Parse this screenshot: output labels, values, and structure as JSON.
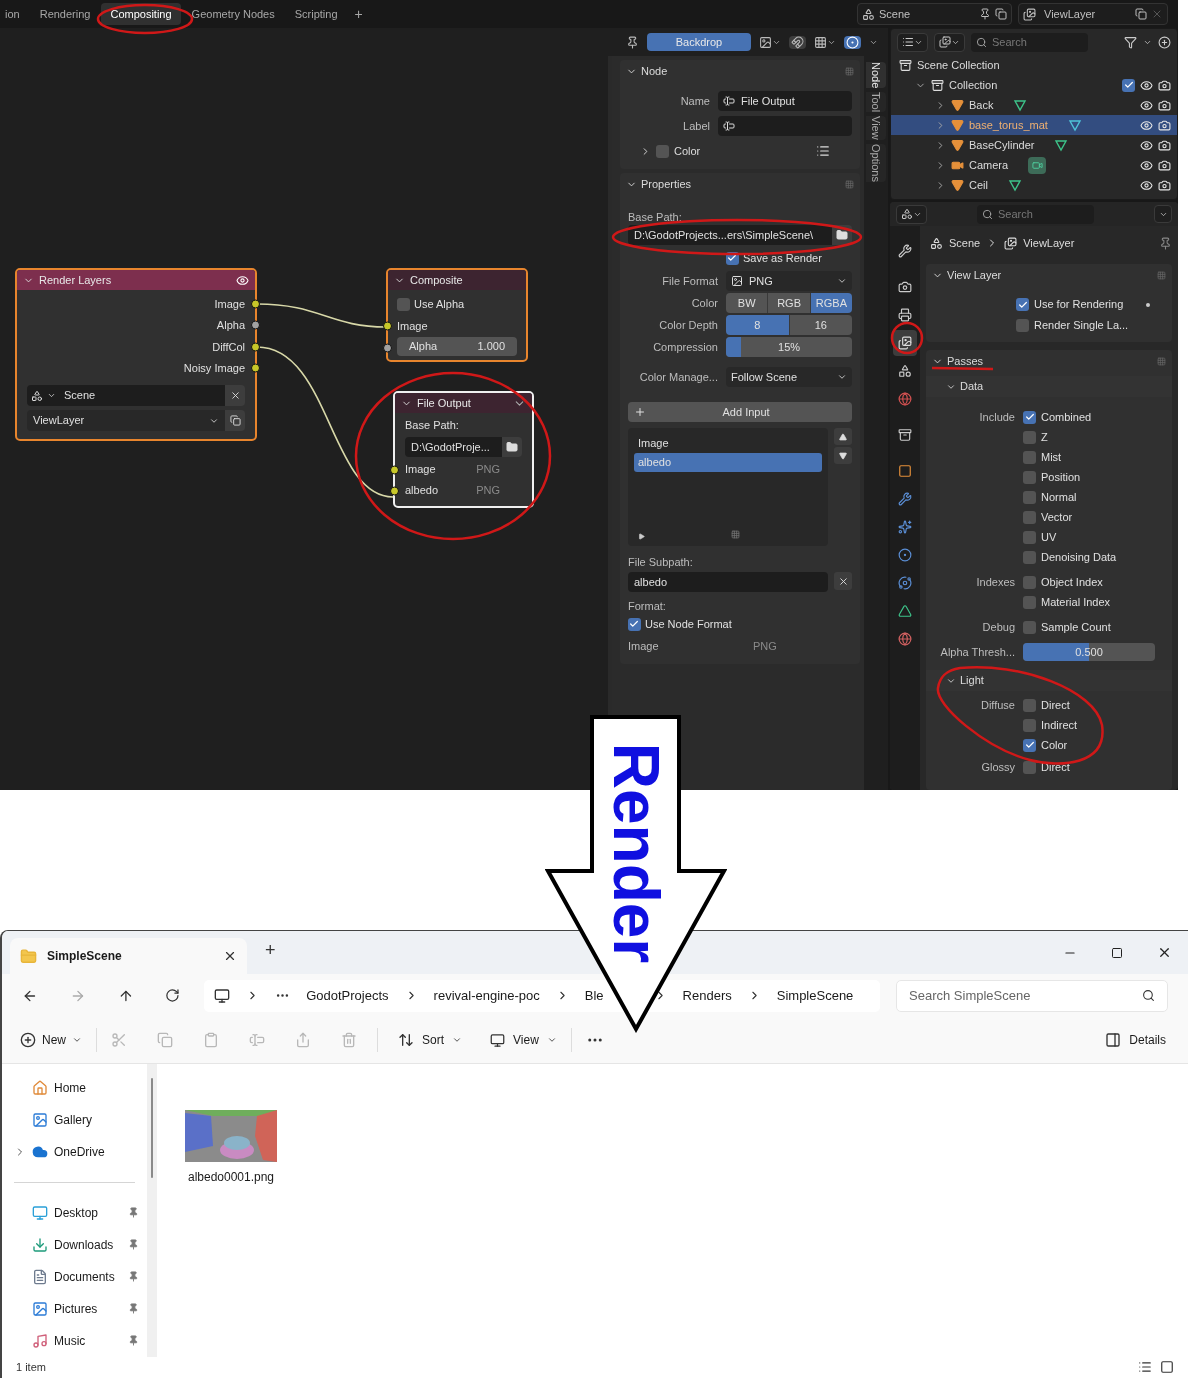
{
  "workspace_tabs": [
    {
      "label": "ion",
      "selected": false
    },
    {
      "label": "Rendering",
      "selected": false
    },
    {
      "label": "Compositing",
      "selected": true
    },
    {
      "label": "Geometry Nodes",
      "selected": false
    },
    {
      "label": "Scripting",
      "selected": false
    }
  ],
  "add_workspace": "+",
  "scene_selector": {
    "scene": "Scene",
    "view_layer": "ViewLayer"
  },
  "node_editor": {
    "backdrop": {
      "label": "Backdrop",
      "on": true
    },
    "render_layers": {
      "title": "Render Layers",
      "selected": true,
      "active": false,
      "outputs": [
        {
          "name": "Image",
          "color": "#c7c729"
        },
        {
          "name": "Alpha",
          "color": "#a1a1a1"
        },
        {
          "name": "DiffCol",
          "color": "#c7c729"
        },
        {
          "name": "Noisy Image",
          "color": "#c7c729"
        }
      ],
      "scene": "Scene",
      "view_layer": "ViewLayer"
    },
    "composite": {
      "title": "Composite",
      "selected": true,
      "active": false,
      "use_alpha": {
        "label": "Use Alpha",
        "checked": false
      },
      "inputs": [
        {
          "name": "Image",
          "color": "#c7c729"
        }
      ],
      "alpha": {
        "label": "Alpha",
        "value": "1.000",
        "color": "#a1a1a1"
      }
    },
    "file_output": {
      "title": "File Output",
      "selected": true,
      "active": true,
      "base_path_label": "Base Path:",
      "base_path": "D:\\GodotProje...",
      "inputs": [
        {
          "name": "Image",
          "format": "PNG",
          "color": "#c7c729"
        },
        {
          "name": "albedo",
          "format": "PNG",
          "color": "#c7c729"
        }
      ]
    }
  },
  "sidebar": {
    "tabs": [
      {
        "label": "Node",
        "selected": true
      },
      {
        "label": "Tool",
        "selected": false
      },
      {
        "label": "View",
        "selected": false
      },
      {
        "label": "Options",
        "selected": false
      }
    ],
    "node_panel": {
      "title": "Node",
      "expanded": true,
      "name": {
        "label": "Name",
        "value": "File Output"
      },
      "label": {
        "label": "Label"
      },
      "color": {
        "label": "Color",
        "checked": false,
        "expanded": false
      }
    },
    "properties_panel": {
      "title": "Properties",
      "expanded": true,
      "base_path_label": "Base Path:",
      "base_path": "D:\\GodotProjects...ers\\SimpleScene\\",
      "save_as_render": {
        "label": "Save as Render",
        "checked": true
      },
      "file_format": {
        "label": "File Format",
        "value": "PNG"
      },
      "color": {
        "label": "Color",
        "options": [
          {
            "label": "BW",
            "selected": false
          },
          {
            "label": "RGB",
            "selected": false
          },
          {
            "label": "RGBA",
            "selected": true
          }
        ]
      },
      "color_depth": {
        "label": "Color Depth",
        "options": [
          {
            "label": "8",
            "selected": true
          },
          {
            "label": "16",
            "selected": false
          }
        ]
      },
      "compression": {
        "label": "Compression",
        "value": "15%",
        "level": 0.12
      },
      "color_management": {
        "label": "Color Manage...",
        "value": "Follow Scene"
      },
      "add_input": "Add Input",
      "inputs": [
        {
          "label": "Image",
          "selected": false
        },
        {
          "label": "albedo",
          "selected": true
        }
      ],
      "file_subpath_label": "File Subpath:",
      "file_subpath": "albedo",
      "format_label": "Format:",
      "use_node_format": {
        "label": "Use Node Format",
        "checked": true
      },
      "format_rows": [
        {
          "label": "Image",
          "value": "PNG"
        }
      ]
    }
  },
  "outliner": {
    "search_placeholder": "Search",
    "tree": [
      {
        "label": "Scene Collection",
        "kind": "scene_collection",
        "selected": false,
        "children": [
          {
            "label": "Collection",
            "kind": "collection",
            "selected": false,
            "expanded": true,
            "checked": true,
            "children": [
              {
                "label": "Back",
                "kind": "mesh",
                "selected": false,
                "expanded": false
              },
              {
                "label": "base_torus_mat",
                "kind": "mesh",
                "selected": true,
                "expanded": false
              },
              {
                "label": "BaseCylinder",
                "kind": "mesh",
                "selected": false,
                "expanded": false
              },
              {
                "label": "Camera",
                "kind": "camera",
                "selected": false,
                "expanded": false
              },
              {
                "label": "Ceil",
                "kind": "mesh",
                "selected": false,
                "expanded": false
              }
            ]
          }
        ]
      }
    ]
  },
  "properties_editor": {
    "search_placeholder": "Search",
    "breadcrumb": [
      {
        "label": "Scene",
        "kind": "scene"
      },
      {
        "label": "ViewLayer",
        "kind": "view_layer"
      }
    ],
    "tabs": [
      {
        "kind": "tool",
        "selected": false
      },
      {
        "kind": "render",
        "selected": false
      },
      {
        "kind": "output",
        "selected": false
      },
      {
        "kind": "view_layer",
        "selected": true
      },
      {
        "kind": "scene",
        "selected": false
      },
      {
        "kind": "world",
        "selected": false
      },
      {
        "kind": "collection",
        "selected": false
      },
      {
        "kind": "object",
        "selected": false
      },
      {
        "kind": "modifiers",
        "selected": false
      },
      {
        "kind": "particles",
        "selected": false
      },
      {
        "kind": "physics",
        "selected": false
      },
      {
        "kind": "constraints",
        "selected": false
      },
      {
        "kind": "data",
        "selected": false
      },
      {
        "kind": "material",
        "selected": false
      }
    ],
    "view_layer_panel": {
      "title": "View Layer",
      "expanded": true,
      "options": [
        {
          "label": "Use for Rendering",
          "checked": true
        },
        {
          "label": "Render Single La...",
          "checked": false
        }
      ]
    },
    "passes_panel": {
      "title": "Passes",
      "expanded": true,
      "subpanels": [
        {
          "title": "Data",
          "expanded": true,
          "groups": [
            {
              "label": "Include",
              "items": [
                {
                  "label": "Combined",
                  "checked": true
                },
                {
                  "label": "Z",
                  "checked": false
                },
                {
                  "label": "Mist",
                  "checked": false
                },
                {
                  "label": "Position",
                  "checked": false
                },
                {
                  "label": "Normal",
                  "checked": false
                },
                {
                  "label": "Vector",
                  "checked": false
                },
                {
                  "label": "UV",
                  "checked": false
                },
                {
                  "label": "Denoising Data",
                  "checked": false
                }
              ]
            },
            {
              "label": "Indexes",
              "items": [
                {
                  "label": "Object Index",
                  "checked": false
                },
                {
                  "label": "Material Index",
                  "checked": false
                }
              ]
            },
            {
              "label": "Debug",
              "items": [
                {
                  "label": "Sample Count",
                  "checked": false
                }
              ]
            }
          ],
          "slider": {
            "label": "Alpha Thresh...",
            "value": "0.500",
            "level": 0.5
          }
        },
        {
          "title": "Light",
          "expanded": true,
          "groups": [
            {
              "label": "Diffuse",
              "items": [
                {
                  "label": "Direct",
                  "checked": false
                },
                {
                  "label": "Indirect",
                  "checked": false
                },
                {
                  "label": "Color",
                  "checked": true
                }
              ]
            },
            {
              "label": "Glossy",
              "items": [
                {
                  "label": "Direct",
                  "checked": false
                }
              ]
            }
          ]
        }
      ]
    }
  },
  "annotation": {
    "label": "Render"
  },
  "explorer": {
    "tab": {
      "title": "SimpleScene"
    },
    "new_tab": "+",
    "breadcrumb": [
      "GodotProjects",
      "revival-engine-poc",
      "Ble",
      "Renders",
      "SimpleScene"
    ],
    "search_placeholder": "Search SimpleScene",
    "toolbar": {
      "new": "New",
      "sort": "Sort",
      "view": "View",
      "details": "Details"
    },
    "nav_quick": [
      {
        "label": "Home",
        "kind": "home",
        "expandable": false
      },
      {
        "label": "Gallery",
        "kind": "gallery",
        "expandable": false
      },
      {
        "label": "OneDrive",
        "kind": "cloud",
        "expandable": true
      }
    ],
    "nav_pinned": [
      {
        "label": "Desktop",
        "kind": "desktop"
      },
      {
        "label": "Downloads",
        "kind": "downloads"
      },
      {
        "label": "Documents",
        "kind": "documents"
      },
      {
        "label": "Pictures",
        "kind": "pictures"
      },
      {
        "label": "Music",
        "kind": "music"
      }
    ],
    "files": [
      {
        "name": "albedo0001.png"
      }
    ],
    "status": "1 item"
  }
}
